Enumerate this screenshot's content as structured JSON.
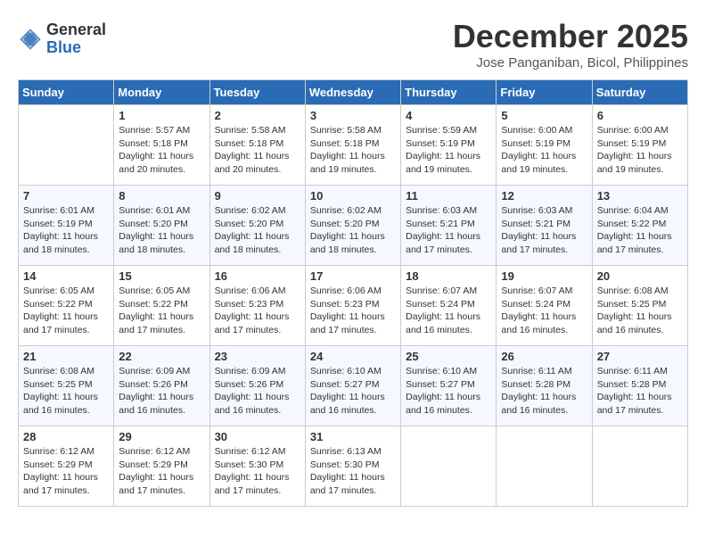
{
  "logo": {
    "general": "General",
    "blue": "Blue"
  },
  "title": "December 2025",
  "subtitle": "Jose Panganiban, Bicol, Philippines",
  "days_of_week": [
    "Sunday",
    "Monday",
    "Tuesday",
    "Wednesday",
    "Thursday",
    "Friday",
    "Saturday"
  ],
  "weeks": [
    [
      {
        "day": "",
        "info": ""
      },
      {
        "day": "1",
        "info": "Sunrise: 5:57 AM\nSunset: 5:18 PM\nDaylight: 11 hours\nand 20 minutes."
      },
      {
        "day": "2",
        "info": "Sunrise: 5:58 AM\nSunset: 5:18 PM\nDaylight: 11 hours\nand 20 minutes."
      },
      {
        "day": "3",
        "info": "Sunrise: 5:58 AM\nSunset: 5:18 PM\nDaylight: 11 hours\nand 19 minutes."
      },
      {
        "day": "4",
        "info": "Sunrise: 5:59 AM\nSunset: 5:19 PM\nDaylight: 11 hours\nand 19 minutes."
      },
      {
        "day": "5",
        "info": "Sunrise: 6:00 AM\nSunset: 5:19 PM\nDaylight: 11 hours\nand 19 minutes."
      },
      {
        "day": "6",
        "info": "Sunrise: 6:00 AM\nSunset: 5:19 PM\nDaylight: 11 hours\nand 19 minutes."
      }
    ],
    [
      {
        "day": "7",
        "info": "Sunrise: 6:01 AM\nSunset: 5:19 PM\nDaylight: 11 hours\nand 18 minutes."
      },
      {
        "day": "8",
        "info": "Sunrise: 6:01 AM\nSunset: 5:20 PM\nDaylight: 11 hours\nand 18 minutes."
      },
      {
        "day": "9",
        "info": "Sunrise: 6:02 AM\nSunset: 5:20 PM\nDaylight: 11 hours\nand 18 minutes."
      },
      {
        "day": "10",
        "info": "Sunrise: 6:02 AM\nSunset: 5:20 PM\nDaylight: 11 hours\nand 18 minutes."
      },
      {
        "day": "11",
        "info": "Sunrise: 6:03 AM\nSunset: 5:21 PM\nDaylight: 11 hours\nand 17 minutes."
      },
      {
        "day": "12",
        "info": "Sunrise: 6:03 AM\nSunset: 5:21 PM\nDaylight: 11 hours\nand 17 minutes."
      },
      {
        "day": "13",
        "info": "Sunrise: 6:04 AM\nSunset: 5:22 PM\nDaylight: 11 hours\nand 17 minutes."
      }
    ],
    [
      {
        "day": "14",
        "info": "Sunrise: 6:05 AM\nSunset: 5:22 PM\nDaylight: 11 hours\nand 17 minutes."
      },
      {
        "day": "15",
        "info": "Sunrise: 6:05 AM\nSunset: 5:22 PM\nDaylight: 11 hours\nand 17 minutes."
      },
      {
        "day": "16",
        "info": "Sunrise: 6:06 AM\nSunset: 5:23 PM\nDaylight: 11 hours\nand 17 minutes."
      },
      {
        "day": "17",
        "info": "Sunrise: 6:06 AM\nSunset: 5:23 PM\nDaylight: 11 hours\nand 17 minutes."
      },
      {
        "day": "18",
        "info": "Sunrise: 6:07 AM\nSunset: 5:24 PM\nDaylight: 11 hours\nand 16 minutes."
      },
      {
        "day": "19",
        "info": "Sunrise: 6:07 AM\nSunset: 5:24 PM\nDaylight: 11 hours\nand 16 minutes."
      },
      {
        "day": "20",
        "info": "Sunrise: 6:08 AM\nSunset: 5:25 PM\nDaylight: 11 hours\nand 16 minutes."
      }
    ],
    [
      {
        "day": "21",
        "info": "Sunrise: 6:08 AM\nSunset: 5:25 PM\nDaylight: 11 hours\nand 16 minutes."
      },
      {
        "day": "22",
        "info": "Sunrise: 6:09 AM\nSunset: 5:26 PM\nDaylight: 11 hours\nand 16 minutes."
      },
      {
        "day": "23",
        "info": "Sunrise: 6:09 AM\nSunset: 5:26 PM\nDaylight: 11 hours\nand 16 minutes."
      },
      {
        "day": "24",
        "info": "Sunrise: 6:10 AM\nSunset: 5:27 PM\nDaylight: 11 hours\nand 16 minutes."
      },
      {
        "day": "25",
        "info": "Sunrise: 6:10 AM\nSunset: 5:27 PM\nDaylight: 11 hours\nand 16 minutes."
      },
      {
        "day": "26",
        "info": "Sunrise: 6:11 AM\nSunset: 5:28 PM\nDaylight: 11 hours\nand 16 minutes."
      },
      {
        "day": "27",
        "info": "Sunrise: 6:11 AM\nSunset: 5:28 PM\nDaylight: 11 hours\nand 17 minutes."
      }
    ],
    [
      {
        "day": "28",
        "info": "Sunrise: 6:12 AM\nSunset: 5:29 PM\nDaylight: 11 hours\nand 17 minutes."
      },
      {
        "day": "29",
        "info": "Sunrise: 6:12 AM\nSunset: 5:29 PM\nDaylight: 11 hours\nand 17 minutes."
      },
      {
        "day": "30",
        "info": "Sunrise: 6:12 AM\nSunset: 5:30 PM\nDaylight: 11 hours\nand 17 minutes."
      },
      {
        "day": "31",
        "info": "Sunrise: 6:13 AM\nSunset: 5:30 PM\nDaylight: 11 hours\nand 17 minutes."
      },
      {
        "day": "",
        "info": ""
      },
      {
        "day": "",
        "info": ""
      },
      {
        "day": "",
        "info": ""
      }
    ]
  ]
}
